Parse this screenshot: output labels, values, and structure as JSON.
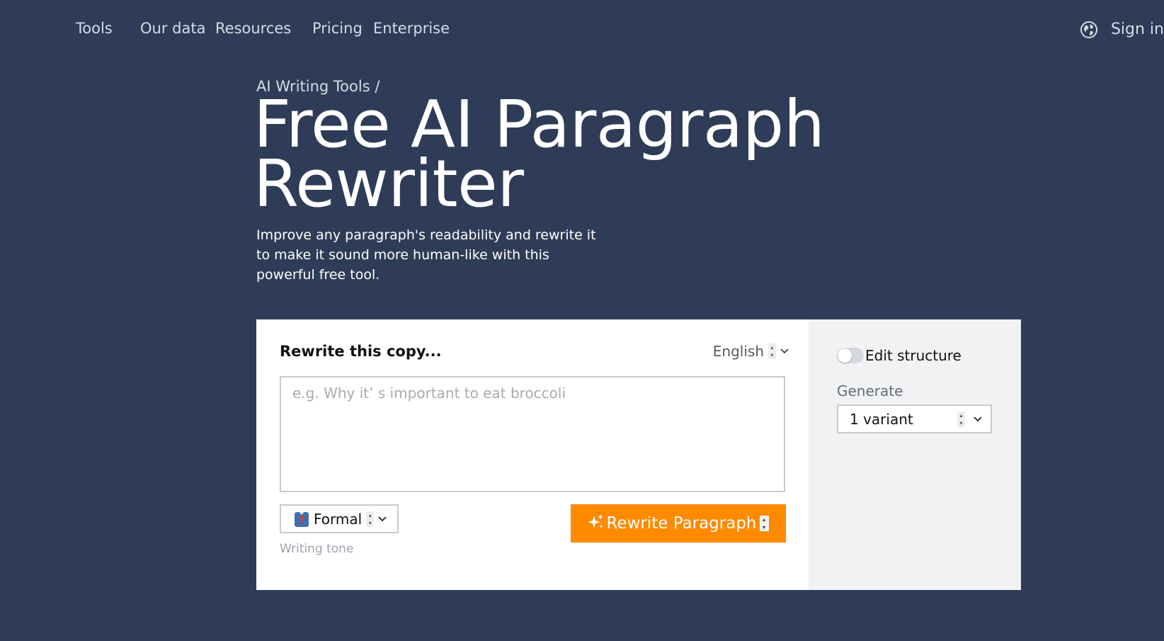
{
  "nav": {
    "items": [
      "Tools",
      "Our data",
      "Resources",
      "Pricing",
      "Enterprise"
    ],
    "sign_in": "Sign in",
    "globe_icon": "globe-icon"
  },
  "hero": {
    "breadcrumb": "AI Writing Tools /",
    "title_line1": "Free AI Paragraph",
    "title_line2": "Rewriter",
    "description": "Improve any paragraph's readability and rewrite it to make it sound more human-like with this powerful free tool."
  },
  "tool": {
    "heading": "Rewrite this copy...",
    "language": "English",
    "input_placeholder": "e.g. Why it’ s important to eat broccoli",
    "input_value": "",
    "tone": "Formal",
    "tone_hint": "Writing tone",
    "rewrite_button": "Rewrite Paragraph",
    "sparkle_icon": "sparkle-icon",
    "tone_icon": "necktie-icon"
  },
  "side": {
    "edit_structure": "Edit structure",
    "edit_structure_on": false,
    "generate_label": "Generate",
    "variants": "1 variant"
  },
  "colors": {
    "background": "#2f3c57",
    "accent": "#ff8a00",
    "side_panel": "#f1f2f4"
  }
}
